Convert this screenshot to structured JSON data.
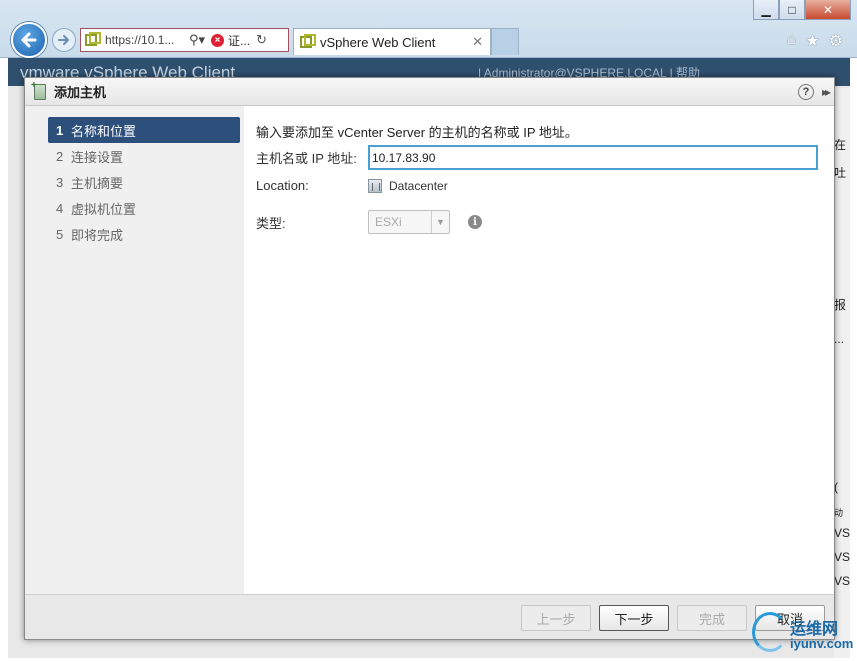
{
  "browser": {
    "address_url": "https://10.1...",
    "address_cert_error": "证...",
    "tab_title": "vSphere Web Client",
    "tab_close": "✕",
    "window_min": "▁",
    "window_max": "□",
    "window_close": "✕",
    "tool_icons": [
      "home-icon",
      "star-icon",
      "gear-icon"
    ]
  },
  "background_app": {
    "header_title": "vmware vSphere Web Client",
    "header_right": "| Administrator@VSPHERE.LOCAL  |  帮助",
    "edge_fragments": [
      "在",
      "吐",
      "报",
      "...",
      "(",
      "动",
      "VS",
      "VS",
      "VS"
    ]
  },
  "dialog": {
    "title": "添加主机",
    "help": "?",
    "expand": "▸▸",
    "steps": [
      {
        "num": "1",
        "label": "名称和位置",
        "active": true
      },
      {
        "num": "2",
        "label": "连接设置",
        "active": false
      },
      {
        "num": "3",
        "label": "主机摘要",
        "active": false
      },
      {
        "num": "4",
        "label": "虚拟机位置",
        "active": false
      },
      {
        "num": "5",
        "label": "即将完成",
        "active": false
      }
    ],
    "intro": "输入要添加至 vCenter Server 的主机的名称或 IP 地址。",
    "host_label": "主机名或 IP 地址:",
    "host_value": "10.17.83.90",
    "location_label": "Location:",
    "location_value": "Datacenter",
    "type_label": "类型:",
    "type_value": "ESXi",
    "buttons": {
      "back": "上一步",
      "next": "下一步",
      "finish": "完成",
      "cancel": "取消"
    }
  },
  "watermark": {
    "line1": "运维网",
    "line2": "iyunv.com"
  }
}
